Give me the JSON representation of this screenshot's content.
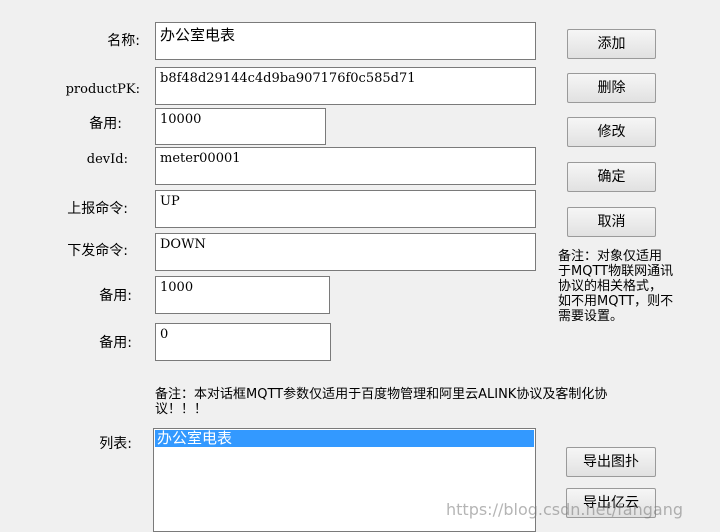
{
  "form": {
    "name": {
      "label": "名称:",
      "value": "办公室电表"
    },
    "productpk": {
      "label": "productPK:",
      "value": "b8f48d29144c4d9ba907176f0c585d71"
    },
    "reserve1": {
      "label": "备用:",
      "value": "10000"
    },
    "devid": {
      "label": "devId:",
      "value": "meter00001"
    },
    "up_cmd": {
      "label": "上报命令:",
      "value": "UP"
    },
    "down_cmd": {
      "label": "下发命令:",
      "value": "DOWN"
    },
    "reserve2": {
      "label": "备用:",
      "value": "1000"
    },
    "reserve3": {
      "label": "备用:",
      "value": "0"
    }
  },
  "buttons": {
    "add": "添加",
    "delete": "删除",
    "modify": "修改",
    "confirm": "确定",
    "cancel": "取消",
    "export_topology": "导出图扑",
    "export_yiyun": "导出亿云"
  },
  "notes": {
    "side_note": [
      "备注：对象仅适用",
      "于MQTT物联网通讯",
      "协议的相关格式，",
      "如不用MQTT，则不",
      "需要设置。"
    ],
    "bottom_note": [
      "备注：本对话框MQTT参数仅适用于百度物管理和阿里云ALINK协议及客制化协",
      "议！！！"
    ]
  },
  "list": {
    "label": "列表:",
    "items": [
      "办公室电表"
    ]
  },
  "watermark": "https://blog.csdn.net/fangang"
}
